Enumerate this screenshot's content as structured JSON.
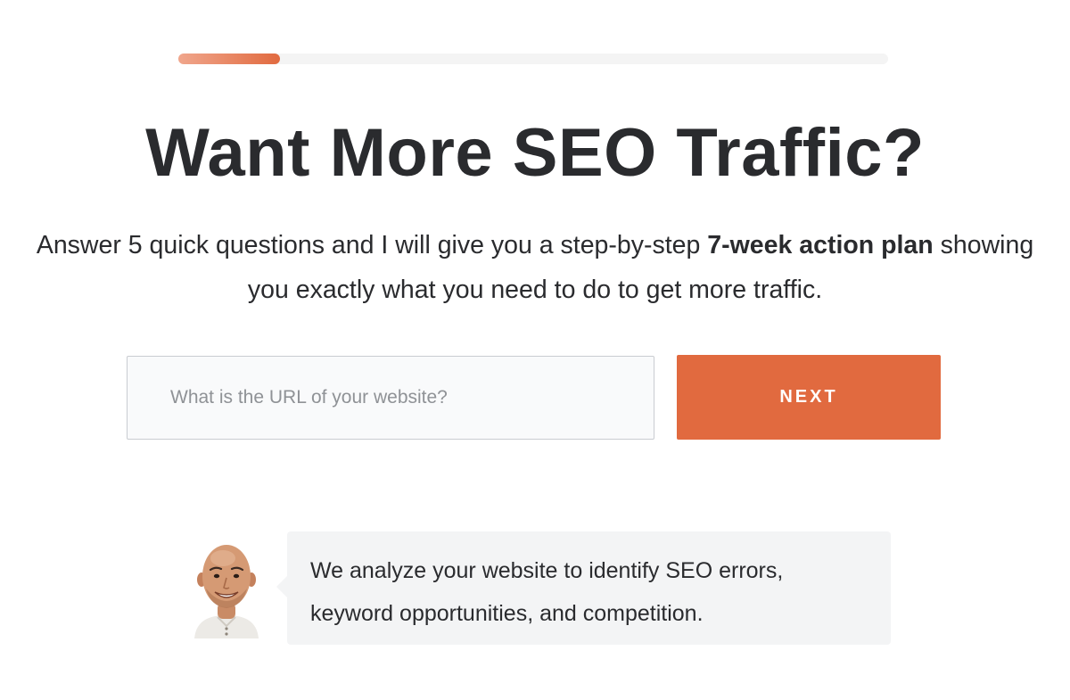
{
  "progress": {
    "percent": 14.3
  },
  "hero": {
    "title": "Want More SEO Traffic?",
    "subtitle_before": "Answer 5 quick questions and I will give you a step-by-step ",
    "subtitle_bold": "7-week action plan",
    "subtitle_after": " showing you exactly what you need to do to get more traffic."
  },
  "form": {
    "url_placeholder": "What is the URL of your website?",
    "url_value": "",
    "next_label": "NEXT"
  },
  "info": {
    "message": "We analyze your website to identify SEO errors, keyword opportunities, and competition."
  },
  "colors": {
    "accent": "#e16a3f",
    "accent_light": "#f0a68c",
    "text": "#2a2b2e",
    "bubble_bg": "#f3f4f5"
  }
}
